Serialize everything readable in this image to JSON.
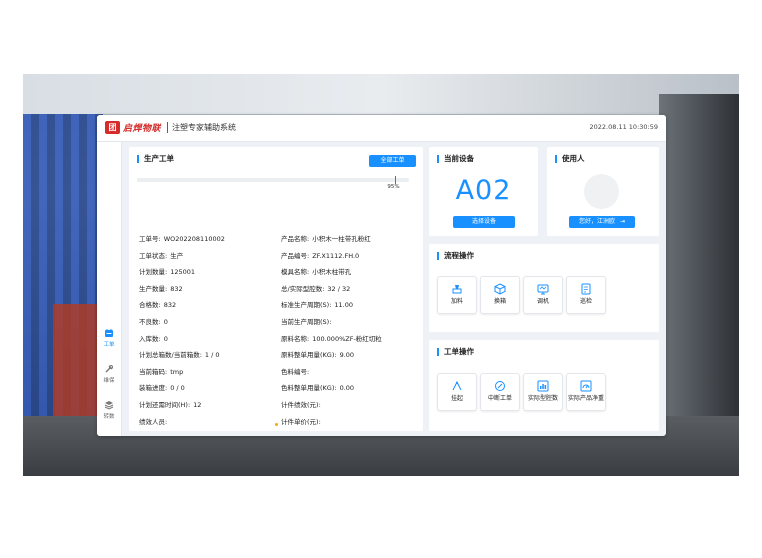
{
  "header": {
    "logo_mark": "团",
    "logo_text": "启焊物联",
    "system_title": "注塑专家辅助系统",
    "datetime": "2022.08.11 10:30:59"
  },
  "sidebar": {
    "items": [
      {
        "label": "工单",
        "icon": "work-order-icon",
        "active": true
      },
      {
        "label": "维保",
        "icon": "wrench-icon",
        "active": false
      },
      {
        "label": "转数",
        "icon": "layers-icon",
        "active": false
      }
    ]
  },
  "production": {
    "title": "生产工单",
    "all_orders_button": "全部工单",
    "progress_percent": 95,
    "progress_label": "95%",
    "left_fields": [
      {
        "label": "工单号:",
        "value": "WO202208110002"
      },
      {
        "label": "工单状态:",
        "value": "生产"
      },
      {
        "label": "计划数量:",
        "value": "125001"
      },
      {
        "label": "生产数量:",
        "value": "832"
      },
      {
        "label": "合格数:",
        "value": "832"
      },
      {
        "label": "不良数:",
        "value": "0"
      },
      {
        "label": "入库数:",
        "value": "0"
      },
      {
        "label": "计划总箱数/当前箱数:",
        "value": "1 / 0"
      },
      {
        "label": "当前箱码:",
        "value": "tmp"
      },
      {
        "label": "装箱进度:",
        "value": "0 / 0"
      },
      {
        "label": "计划还需时间(H):",
        "value": "12"
      },
      {
        "label": "绩效人员:",
        "value": ""
      }
    ],
    "right_fields": [
      {
        "label": "产品名称:",
        "value": "小积木一柱带孔粉红"
      },
      {
        "label": "产品编号:",
        "value": "ZF.X1112.FH.0"
      },
      {
        "label": "模具名称:",
        "value": "小积木柱带孔"
      },
      {
        "label": "总/实际型腔数:",
        "value": "32 / 32"
      },
      {
        "label": "标准生产周期(S):",
        "value": "11.00"
      },
      {
        "label": "当前生产周期(S):",
        "value": ""
      },
      {
        "label": "原料名称:",
        "value": "100.000%ZF-粉红切粒"
      },
      {
        "label": "原料整单用量(KG):",
        "value": "9.00"
      },
      {
        "label": "色料编号:",
        "value": ""
      },
      {
        "label": "色料整单用量(KG):",
        "value": "0.00"
      },
      {
        "label": "计件绩效(元):",
        "value": ""
      },
      {
        "label": "计件单价(元):",
        "value": ""
      }
    ]
  },
  "current_device": {
    "title": "当前设备",
    "code": "A02",
    "select_button": "选择设备"
  },
  "user": {
    "title": "使用人",
    "greeting_button": "您好，江洲欧",
    "logout_icon": "logout-icon"
  },
  "process_ops": {
    "title": "流程操作",
    "buttons": [
      {
        "label": "加料",
        "icon": "feed-icon"
      },
      {
        "label": "换箱",
        "icon": "box-icon"
      },
      {
        "label": "调机",
        "icon": "monitor-icon"
      },
      {
        "label": "巡检",
        "icon": "checklist-icon"
      }
    ]
  },
  "order_ops": {
    "title": "工单操作",
    "buttons": [
      {
        "label": "挂起",
        "icon": "hang-icon"
      },
      {
        "label": "中断工单",
        "icon": "interrupt-icon"
      },
      {
        "label": "实际型腔数",
        "icon": "bar-chart-icon"
      },
      {
        "label": "实际产品净重",
        "icon": "gauge-icon"
      }
    ]
  },
  "colors": {
    "accent": "#1890ff",
    "brand": "#d52b2b",
    "progress_marker": "#e23a3a",
    "page_dot": "#f5a623"
  }
}
